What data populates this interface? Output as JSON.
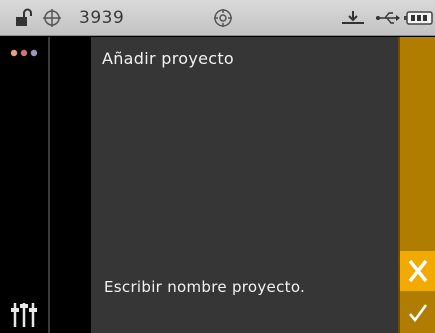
{
  "status_bar": {
    "icons": [
      "lock-open-icon",
      "target-icon",
      "calibration-icon",
      "dock-icon",
      "usb-icon",
      "battery-icon"
    ],
    "number": "3939"
  },
  "sidebar": {
    "icons": [
      "color-dots-icon",
      "sliders-icon"
    ],
    "dot_colors": [
      "#e8a080",
      "#c87878",
      "#9a9ab8"
    ]
  },
  "content": {
    "title": "Añadir proyecto",
    "prompt": "Escribir nombre proyecto."
  },
  "actions": {
    "cancel_icon": "x-icon",
    "confirm_icon": "checkmark-icon"
  },
  "colors": {
    "accent": "#f0aa00",
    "accent_dark": "#b07d00",
    "panel": "#363636",
    "status_bar": "#cfcfcf"
  }
}
